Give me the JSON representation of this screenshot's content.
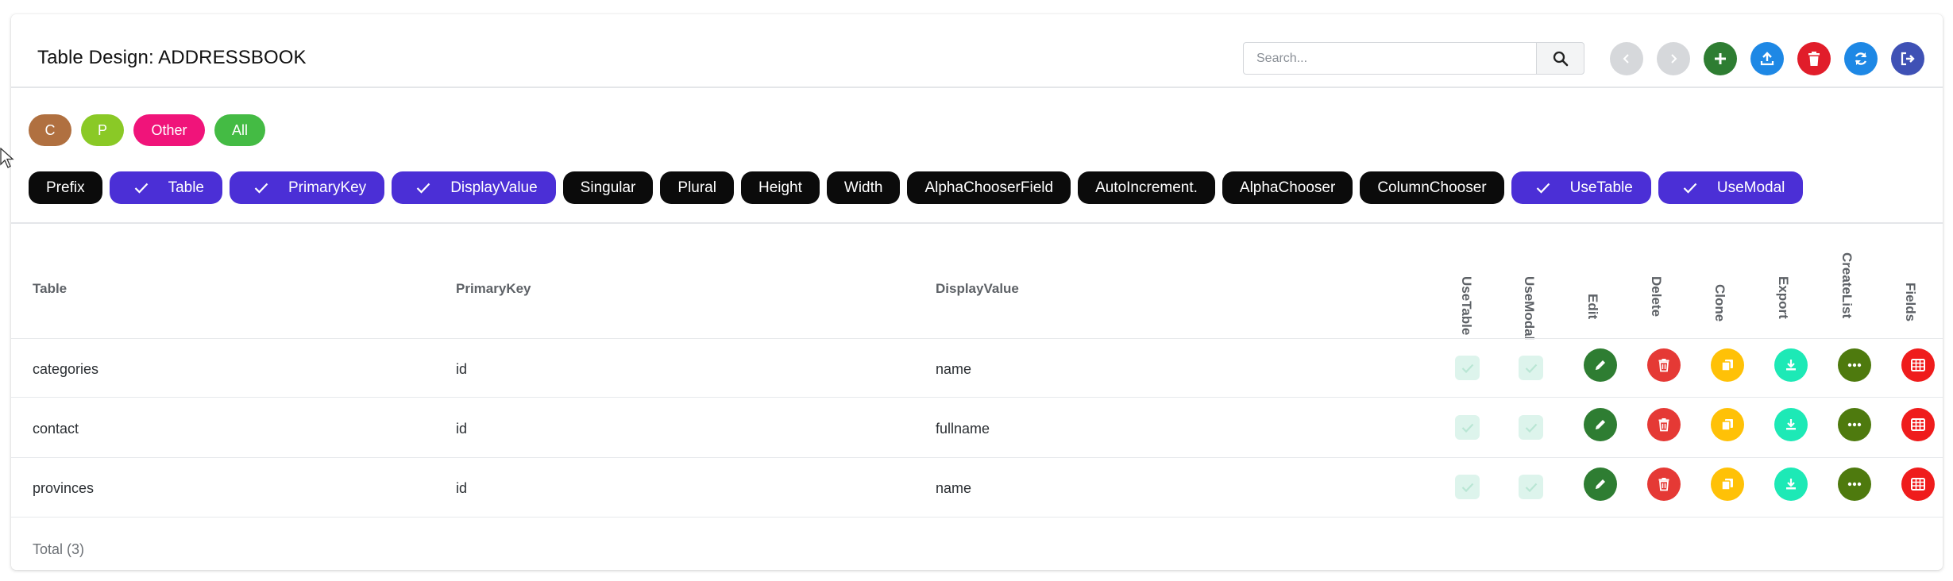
{
  "header": {
    "title": "Table Design: ADDRESSBOOK",
    "search_placeholder": "Search...",
    "toolbar": [
      {
        "name": "back-button",
        "icon": "chevron-left-icon",
        "color": "#d6d8db"
      },
      {
        "name": "forward-button",
        "icon": "chevron-right-icon",
        "color": "#d6d8db"
      },
      {
        "name": "add-button",
        "icon": "plus-icon",
        "color": "#2e7d32"
      },
      {
        "name": "upload-button",
        "icon": "upload-icon",
        "color": "#1e88e5"
      },
      {
        "name": "delete-button",
        "icon": "trash-icon",
        "color": "#e11d2a"
      },
      {
        "name": "refresh-button",
        "icon": "refresh-icon",
        "color": "#1e88e5"
      },
      {
        "name": "exit-button",
        "icon": "sign-out-icon",
        "color": "#3f51b5"
      }
    ]
  },
  "filters": [
    {
      "label": "C",
      "color": "#b07040"
    },
    {
      "label": "P",
      "color": "#8ac926"
    },
    {
      "label": "Other",
      "color": "#f0147a"
    },
    {
      "label": "All",
      "color": "#44bb44"
    }
  ],
  "column_chips": [
    {
      "label": "Prefix",
      "checked": false
    },
    {
      "label": "Table",
      "checked": true
    },
    {
      "label": "PrimaryKey",
      "checked": true
    },
    {
      "label": "DisplayValue",
      "checked": true
    },
    {
      "label": "Singular",
      "checked": false
    },
    {
      "label": "Plural",
      "checked": false
    },
    {
      "label": "Height",
      "checked": false
    },
    {
      "label": "Width",
      "checked": false
    },
    {
      "label": "AlphaChooserField",
      "checked": false
    },
    {
      "label": "AutoIncrement.",
      "checked": false
    },
    {
      "label": "AlphaChooser",
      "checked": false
    },
    {
      "label": "ColumnChooser",
      "checked": false
    },
    {
      "label": "UseTable",
      "checked": true
    },
    {
      "label": "UseModal",
      "checked": true
    }
  ],
  "table": {
    "columns": [
      "Table",
      "PrimaryKey",
      "DisplayValue"
    ],
    "vertical_columns": [
      "UseTable",
      "UseModal",
      "Edit",
      "Delete",
      "Clone",
      "Export",
      "CreateList",
      "Fields"
    ],
    "rows": [
      {
        "table": "categories",
        "primary_key": "id",
        "display_value": "name",
        "use_table": true,
        "use_modal": true
      },
      {
        "table": "contact",
        "primary_key": "id",
        "display_value": "fullname",
        "use_table": true,
        "use_modal": true
      },
      {
        "table": "provinces",
        "primary_key": "id",
        "display_value": "name",
        "use_table": true,
        "use_modal": true
      }
    ],
    "actions": [
      {
        "name": "edit",
        "icon": "pencil-icon",
        "color": "#2e7d32"
      },
      {
        "name": "delete",
        "icon": "trash-icon",
        "color": "#e53935"
      },
      {
        "name": "clone",
        "icon": "copy-icon",
        "color": "#ffc107"
      },
      {
        "name": "export",
        "icon": "download-icon",
        "color": "#1de9b6"
      },
      {
        "name": "create-list",
        "icon": "ellipsis-icon",
        "color": "#4e7a0e"
      },
      {
        "name": "fields",
        "icon": "grid-icon",
        "color": "#ef1c1c"
      }
    ],
    "footer": "Total (3)"
  }
}
